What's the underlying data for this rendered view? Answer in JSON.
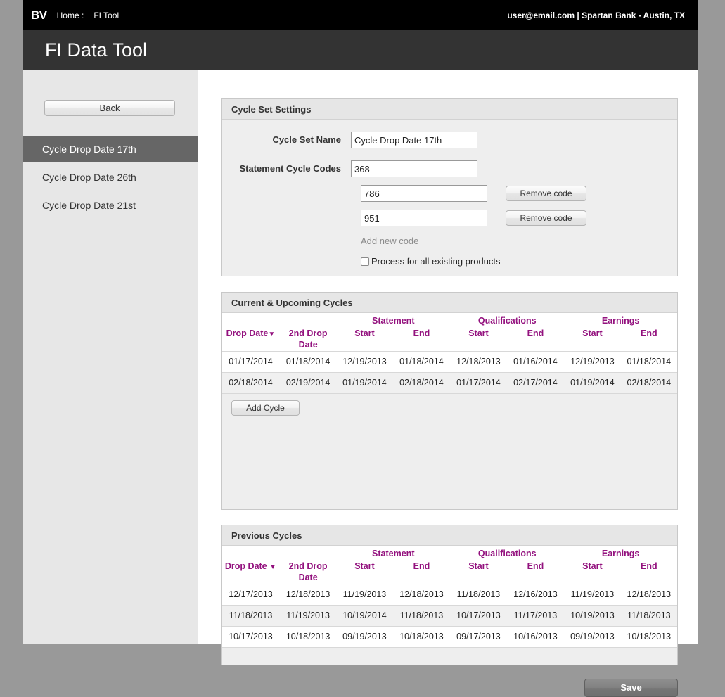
{
  "topbar": {
    "logo": "BV",
    "breadcrumb_home": "Home :",
    "breadcrumb_current": "FI Tool",
    "account": "user@email.com | Spartan Bank - Austin, TX"
  },
  "page_title": "FI Data Tool",
  "sidebar": {
    "back_label": "Back",
    "items": [
      {
        "label": "Cycle Drop Date 17th",
        "active": true
      },
      {
        "label": "Cycle Drop Date 26th",
        "active": false
      },
      {
        "label": "Cycle Drop Date 21st",
        "active": false
      }
    ]
  },
  "settings": {
    "panel_title": "Cycle Set Settings",
    "name_label": "Cycle Set Name",
    "name_value": "Cycle Drop Date 17th",
    "name_placeholder": "",
    "codes_label": "Statement Cycle Codes",
    "codes": [
      {
        "value": "368",
        "remove_label": ""
      },
      {
        "value": "786",
        "remove_label": "Remove code"
      },
      {
        "value": "951",
        "remove_label": "Remove code"
      }
    ],
    "add_new_code": "Add new code",
    "process_all_label": "Process for all existing products",
    "process_all_checked": false
  },
  "table_headers": {
    "groups": [
      "",
      "",
      "Statement",
      "Qualifications",
      "Earnings"
    ],
    "columns": [
      "Drop Date",
      "2nd Drop Date",
      "Start",
      "End",
      "Start",
      "End",
      "Start",
      "End"
    ],
    "sort_caret": "▼"
  },
  "current_cycles": {
    "panel_title": "Current & Upcoming Cycles",
    "add_cycle_label": "Add Cycle",
    "rows": [
      [
        "01/17/2014",
        "01/18/2014",
        "12/19/2013",
        "01/18/2014",
        "12/18/2013",
        "01/16/2014",
        "12/19/2013",
        "01/18/2014"
      ],
      [
        "02/18/2014",
        "02/19/2014",
        "01/19/2014",
        "02/18/2014",
        "01/17/2014",
        "02/17/2014",
        "01/19/2014",
        "02/18/2014"
      ]
    ]
  },
  "previous_cycles": {
    "panel_title": "Previous Cycles",
    "rows": [
      [
        "12/17/2013",
        "12/18/2013",
        "11/19/2013",
        "12/18/2013",
        "11/18/2013",
        "12/16/2013",
        "11/19/2013",
        "12/18/2013"
      ],
      [
        "11/18/2013",
        "11/19/2013",
        "10/19/2014",
        "11/18/2013",
        "10/17/2013",
        "11/17/2013",
        "10/19/2013",
        "11/18/2013"
      ],
      [
        "10/17/2013",
        "10/18/2013",
        "09/19/2013",
        "10/18/2013",
        "09/17/2013",
        "10/16/2013",
        "09/19/2013",
        "10/18/2013"
      ]
    ]
  },
  "save_label": "Save",
  "colors": {
    "header_accent": "#93117E",
    "topbar_bg": "#000000",
    "title_bg": "#333333",
    "sidebar_active": "#666666",
    "page_bg": "#999999"
  }
}
